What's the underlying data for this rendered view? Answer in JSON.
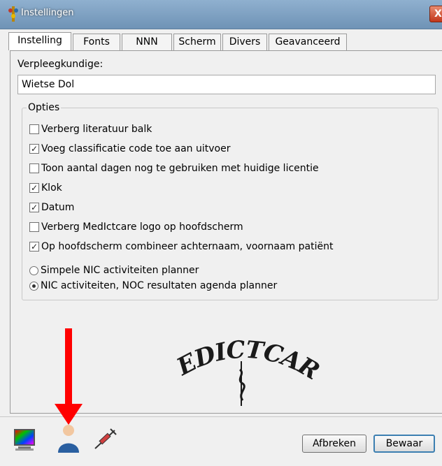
{
  "window": {
    "title": "Instellingen",
    "close_label": "X"
  },
  "tabs": [
    {
      "label": "Instelling",
      "active": true
    },
    {
      "label": "Fonts",
      "active": false
    },
    {
      "label": "NNN",
      "active": false
    },
    {
      "label": "Scherm",
      "active": false
    },
    {
      "label": "Divers",
      "active": false
    },
    {
      "label": "Geavanceerd",
      "active": false
    }
  ],
  "nurse": {
    "label": "Verpleegkundige:",
    "value": "Wietse Dol"
  },
  "options": {
    "legend": "Opties",
    "checkboxes": [
      {
        "label": "Verberg literatuur balk",
        "checked": false
      },
      {
        "label": "Voeg classificatie code toe aan uitvoer",
        "checked": true
      },
      {
        "label": "Toon aantal dagen nog te gebruiken met huidige licentie",
        "checked": false
      },
      {
        "label": "Klok",
        "checked": true
      },
      {
        "label": "Datum",
        "checked": true
      },
      {
        "label": "Verberg MedIctcare logo op hoofdscherm",
        "checked": false
      },
      {
        "label": "Op hoofdscherm combineer achternaam, voornaam patiënt",
        "checked": true
      }
    ],
    "radios": [
      {
        "label": "Simpele NIC activiteiten planner",
        "selected": false
      },
      {
        "label": "NIC activiteiten, NOC resultaten agenda planner",
        "selected": true
      }
    ]
  },
  "logo": {
    "text": "MEDICTCARE"
  },
  "bottom_icons": [
    "monitor-icon",
    "user-icon",
    "syringe-icon"
  ],
  "buttons": {
    "cancel_label": "Afbreken",
    "save_label": "Bewaar"
  },
  "colors": {
    "titlebar": "#7ea0c2",
    "arrow": "#ff0000",
    "user": "#2a5fa0",
    "close": "#d1502f"
  }
}
